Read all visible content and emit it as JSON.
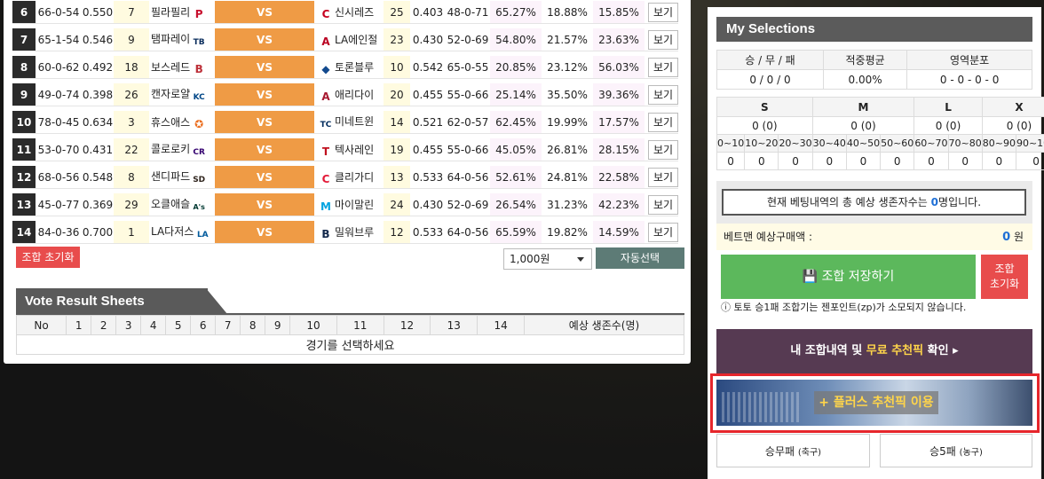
{
  "games": [
    {
      "no": "6",
      "rec1": "66-0-54",
      "pct1": "0.550",
      "rank1": "7",
      "team1": "필라필리",
      "logo1": "P",
      "logo1_color": "#c8102e",
      "vs": "VS",
      "team2": "신시레즈",
      "logo2": "C",
      "logo2_color": "#c6011f",
      "rank2": "25",
      "pct2": "0.403",
      "rec2": "48-0-71",
      "p1": "65.27%",
      "p2": "18.88%",
      "p3": "15.85%",
      "view": "보기"
    },
    {
      "no": "7",
      "rec1": "65-1-54",
      "pct1": "0.546",
      "rank1": "9",
      "team1": "탬파레이",
      "logo1": "TB",
      "logo1_color": "#092c5c",
      "vs": "VS",
      "team2": "LA에인절",
      "logo2": "A",
      "logo2_color": "#ba0021",
      "rank2": "23",
      "pct2": "0.430",
      "rec2": "52-0-69",
      "p1": "54.80%",
      "p2": "21.57%",
      "p3": "23.63%",
      "view": "보기"
    },
    {
      "no": "8",
      "rec1": "60-0-62",
      "pct1": "0.492",
      "rank1": "18",
      "team1": "보스레드",
      "logo1": "B",
      "logo1_color": "#bd3039",
      "vs": "VS",
      "team2": "토론블루",
      "logo2": "◆",
      "logo2_color": "#134a8e",
      "rank2": "10",
      "pct2": "0.542",
      "rec2": "65-0-55",
      "p1": "20.85%",
      "p2": "23.12%",
      "p3": "56.03%",
      "view": "보기"
    },
    {
      "no": "9",
      "rec1": "49-0-74",
      "pct1": "0.398",
      "rank1": "26",
      "team1": "캔자로얄",
      "logo1": "KC",
      "logo1_color": "#004687",
      "vs": "VS",
      "team2": "애리다이",
      "logo2": "A",
      "logo2_color": "#a71930",
      "rank2": "20",
      "pct2": "0.455",
      "rec2": "55-0-66",
      "p1": "25.14%",
      "p2": "35.50%",
      "p3": "39.36%",
      "view": "보기"
    },
    {
      "no": "10",
      "rec1": "78-0-45",
      "pct1": "0.634",
      "rank1": "3",
      "team1": "휴스애스",
      "logo1": "✪",
      "logo1_color": "#eb6e1f",
      "vs": "VS",
      "team2": "미네트윈",
      "logo2": "TC",
      "logo2_color": "#002b5c",
      "rank2": "14",
      "pct2": "0.521",
      "rec2": "62-0-57",
      "p1": "62.45%",
      "p2": "19.99%",
      "p3": "17.57%",
      "view": "보기"
    },
    {
      "no": "11",
      "rec1": "53-0-70",
      "pct1": "0.431",
      "rank1": "22",
      "team1": "콜로로키",
      "logo1": "CR",
      "logo1_color": "#33006f",
      "vs": "VS",
      "team2": "텍사레인",
      "logo2": "T",
      "logo2_color": "#c0111f",
      "rank2": "19",
      "pct2": "0.455",
      "rec2": "55-0-66",
      "p1": "45.05%",
      "p2": "26.81%",
      "p3": "28.15%",
      "view": "보기"
    },
    {
      "no": "12",
      "rec1": "68-0-56",
      "pct1": "0.548",
      "rank1": "8",
      "team1": "샌디파드",
      "logo1": "SD",
      "logo1_color": "#2f241d",
      "vs": "VS",
      "team2": "클리가디",
      "logo2": "C",
      "logo2_color": "#e31937",
      "rank2": "13",
      "pct2": "0.533",
      "rec2": "64-0-56",
      "p1": "52.61%",
      "p2": "24.81%",
      "p3": "22.58%",
      "view": "보기"
    },
    {
      "no": "13",
      "rec1": "45-0-77",
      "pct1": "0.369",
      "rank1": "29",
      "team1": "오클애슬",
      "logo1": "A's",
      "logo1_color": "#003831",
      "vs": "VS",
      "team2": "마이말린",
      "logo2": "M",
      "logo2_color": "#00a3e0",
      "rank2": "24",
      "pct2": "0.430",
      "rec2": "52-0-69",
      "p1": "26.54%",
      "p2": "31.23%",
      "p3": "42.23%",
      "view": "보기"
    },
    {
      "no": "14",
      "rec1": "84-0-36",
      "pct1": "0.700",
      "rank1": "1",
      "team1": "LA다저스",
      "logo1": "LA",
      "logo1_color": "#005a9c",
      "vs": "VS",
      "team2": "밀워브루",
      "logo2": "B",
      "logo2_color": "#12284b",
      "rank2": "12",
      "pct2": "0.533",
      "rec2": "64-0-56",
      "p1": "65.59%",
      "p2": "19.82%",
      "p3": "14.59%",
      "view": "보기"
    }
  ],
  "controls": {
    "reset_label": "조합 초기화",
    "amount_value": "1,000원",
    "auto_select_label": "자동선택"
  },
  "vote": {
    "title": "Vote Result Sheets",
    "headers": [
      "No",
      "1",
      "2",
      "3",
      "4",
      "5",
      "6",
      "7",
      "8",
      "9",
      "10",
      "11",
      "12",
      "13",
      "14",
      "예상 생존수(명)"
    ],
    "empty_message": "경기를 선택하세요"
  },
  "selections": {
    "title": "My Selections",
    "stat_headers": [
      "승 / 무 / 패",
      "적중평균",
      "영역분포"
    ],
    "stat_values": [
      "0 / 0 / 0",
      "0.00%",
      "0 - 0 - 0 - 0"
    ],
    "size_headers": [
      "S",
      "M",
      "L",
      "X"
    ],
    "size_values": [
      "0 (0)",
      "0 (0)",
      "0 (0)",
      "0 (0)"
    ],
    "ranges": [
      "0~10",
      "10~20",
      "20~30",
      "30~40",
      "40~50",
      "50~60",
      "60~70",
      "70~80",
      "80~90",
      "90~100"
    ],
    "range_values": [
      "0",
      "0",
      "0",
      "0",
      "0",
      "0",
      "0",
      "0",
      "0",
      "0"
    ],
    "survivor_prefix": "현재 베팅내역의 총 예상 생존자수는",
    "survivor_count": "0",
    "survivor_suffix": "명입니다.",
    "price_label": "베트맨 예상구매액 :",
    "price_value": "0",
    "price_unit": "원",
    "save_label": "조합 저장하기",
    "reset_line1": "조합",
    "reset_line2": "초기화",
    "notice": "토토 승1패 조합기는 젠포인트(zp)가 소모되지 않습니다.",
    "my_combo_prefix": "내 조합내역 및",
    "my_combo_highlight": "무료 추천픽",
    "my_combo_suffix": "확인",
    "banner_label": "+ 플러스 추천픽 이용",
    "btn1_label": "승무패",
    "btn1_sub": "(축구)",
    "btn2_label": "승5패",
    "btn2_sub": "(농구)"
  }
}
